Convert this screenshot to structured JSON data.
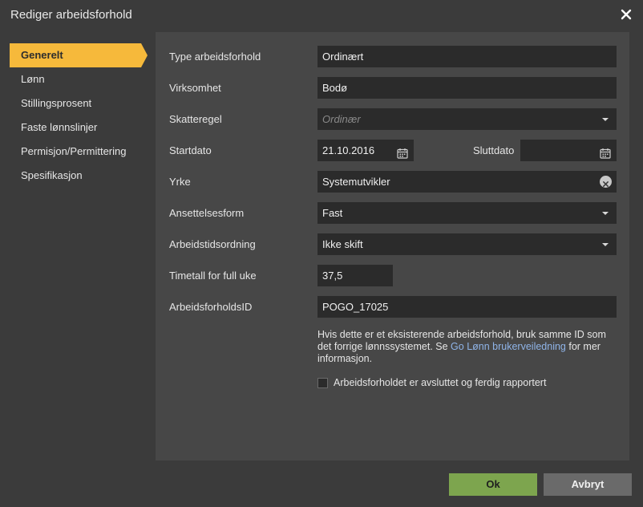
{
  "window": {
    "title": "Rediger arbeidsforhold"
  },
  "sidebar": {
    "items": [
      {
        "label": "Generelt",
        "active": true
      },
      {
        "label": "Lønn"
      },
      {
        "label": "Stillingsprosent"
      },
      {
        "label": "Faste lønnslinjer"
      },
      {
        "label": "Permisjon/Permittering"
      },
      {
        "label": "Spesifikasjon"
      }
    ]
  },
  "form": {
    "type": {
      "label": "Type arbeidsforhold",
      "value": "Ordinært"
    },
    "company": {
      "label": "Virksomhet",
      "value": "Bodø"
    },
    "tax_rule": {
      "label": "Skatteregel",
      "placeholder": "Ordinær"
    },
    "start_date": {
      "label": "Startdato",
      "value": "21.10.2016"
    },
    "end_date": {
      "label": "Sluttdato",
      "value": ""
    },
    "occupation": {
      "label": "Yrke",
      "value": "Systemutvikler"
    },
    "employment_form": {
      "label": "Ansettelsesform",
      "value": "Fast"
    },
    "working_time": {
      "label": "Arbeidstidsordning",
      "value": "Ikke skift"
    },
    "hours": {
      "label": "Timetall for full uke",
      "value": "37,5"
    },
    "employment_id": {
      "label": "ArbeidsforholdsID",
      "value": "POGO_17025"
    },
    "help": {
      "before": "Hvis dette er et eksisterende arbeidsforhold, bruk samme ID som det forrige lønnssystemet. Se ",
      "link": "Go Lønn brukerveiledning",
      "after": " for mer informasjon."
    },
    "ended_checkbox": {
      "label": "Arbeidsforholdet er avsluttet og ferdig rapportert"
    }
  },
  "buttons": {
    "ok": "Ok",
    "cancel": "Avbryt"
  },
  "colors": {
    "accent": "#f6b93b",
    "ok": "#7da54e",
    "link": "#8fb4e8"
  }
}
